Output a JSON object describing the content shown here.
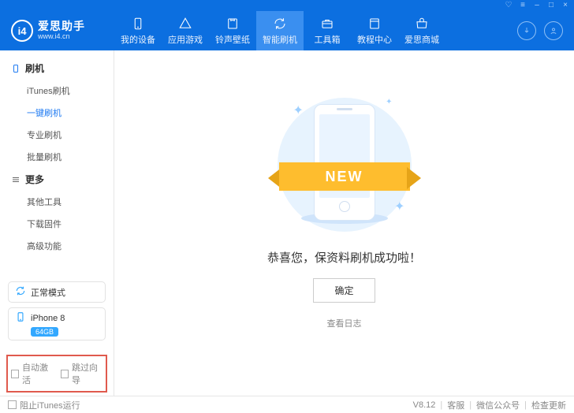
{
  "app": {
    "name": "爱思助手",
    "url": "www.i4.cn",
    "logo_letters": "i4"
  },
  "window_buttons": [
    "cart-icon",
    "menu-icon",
    "minimize-icon",
    "maximize-icon",
    "close-icon"
  ],
  "header": {
    "tabs": [
      {
        "id": "device",
        "label": "我的设备",
        "icon": "phone-icon"
      },
      {
        "id": "apps",
        "label": "应用游戏",
        "icon": "apps-icon"
      },
      {
        "id": "ringtone",
        "label": "铃声壁纸",
        "icon": "note-icon"
      },
      {
        "id": "flash",
        "label": "智能刷机",
        "icon": "refresh-icon",
        "active": true
      },
      {
        "id": "tools",
        "label": "工具箱",
        "icon": "toolbox-icon"
      },
      {
        "id": "tutorial",
        "label": "教程中心",
        "icon": "book-icon"
      },
      {
        "id": "store",
        "label": "爱思商城",
        "icon": "shop-icon"
      }
    ],
    "right_icons": [
      "download-icon",
      "user-icon"
    ]
  },
  "sidebar": {
    "section1_title": "刷机",
    "items1": [
      {
        "label": "iTunes刷机"
      },
      {
        "label": "一键刷机",
        "active": true
      },
      {
        "label": "专业刷机"
      },
      {
        "label": "批量刷机"
      }
    ],
    "section2_title": "更多",
    "items2": [
      {
        "label": "其他工具"
      },
      {
        "label": "下载固件"
      },
      {
        "label": "高级功能"
      }
    ],
    "mode_label": "正常模式",
    "device_name": "iPhone 8",
    "device_badge": "64GB",
    "opt_auto_activate": "自动激活",
    "opt_skip_guide": "跳过向导"
  },
  "main": {
    "ribbon_text": "NEW",
    "success_message": "恭喜您，保资料刷机成功啦！",
    "ok_button": "确定",
    "view_log": "查看日志"
  },
  "footer": {
    "block_itunes": "阻止iTunes运行",
    "version": "V8.12",
    "support": "客服",
    "wechat": "微信公众号",
    "check_update": "检查更新"
  }
}
